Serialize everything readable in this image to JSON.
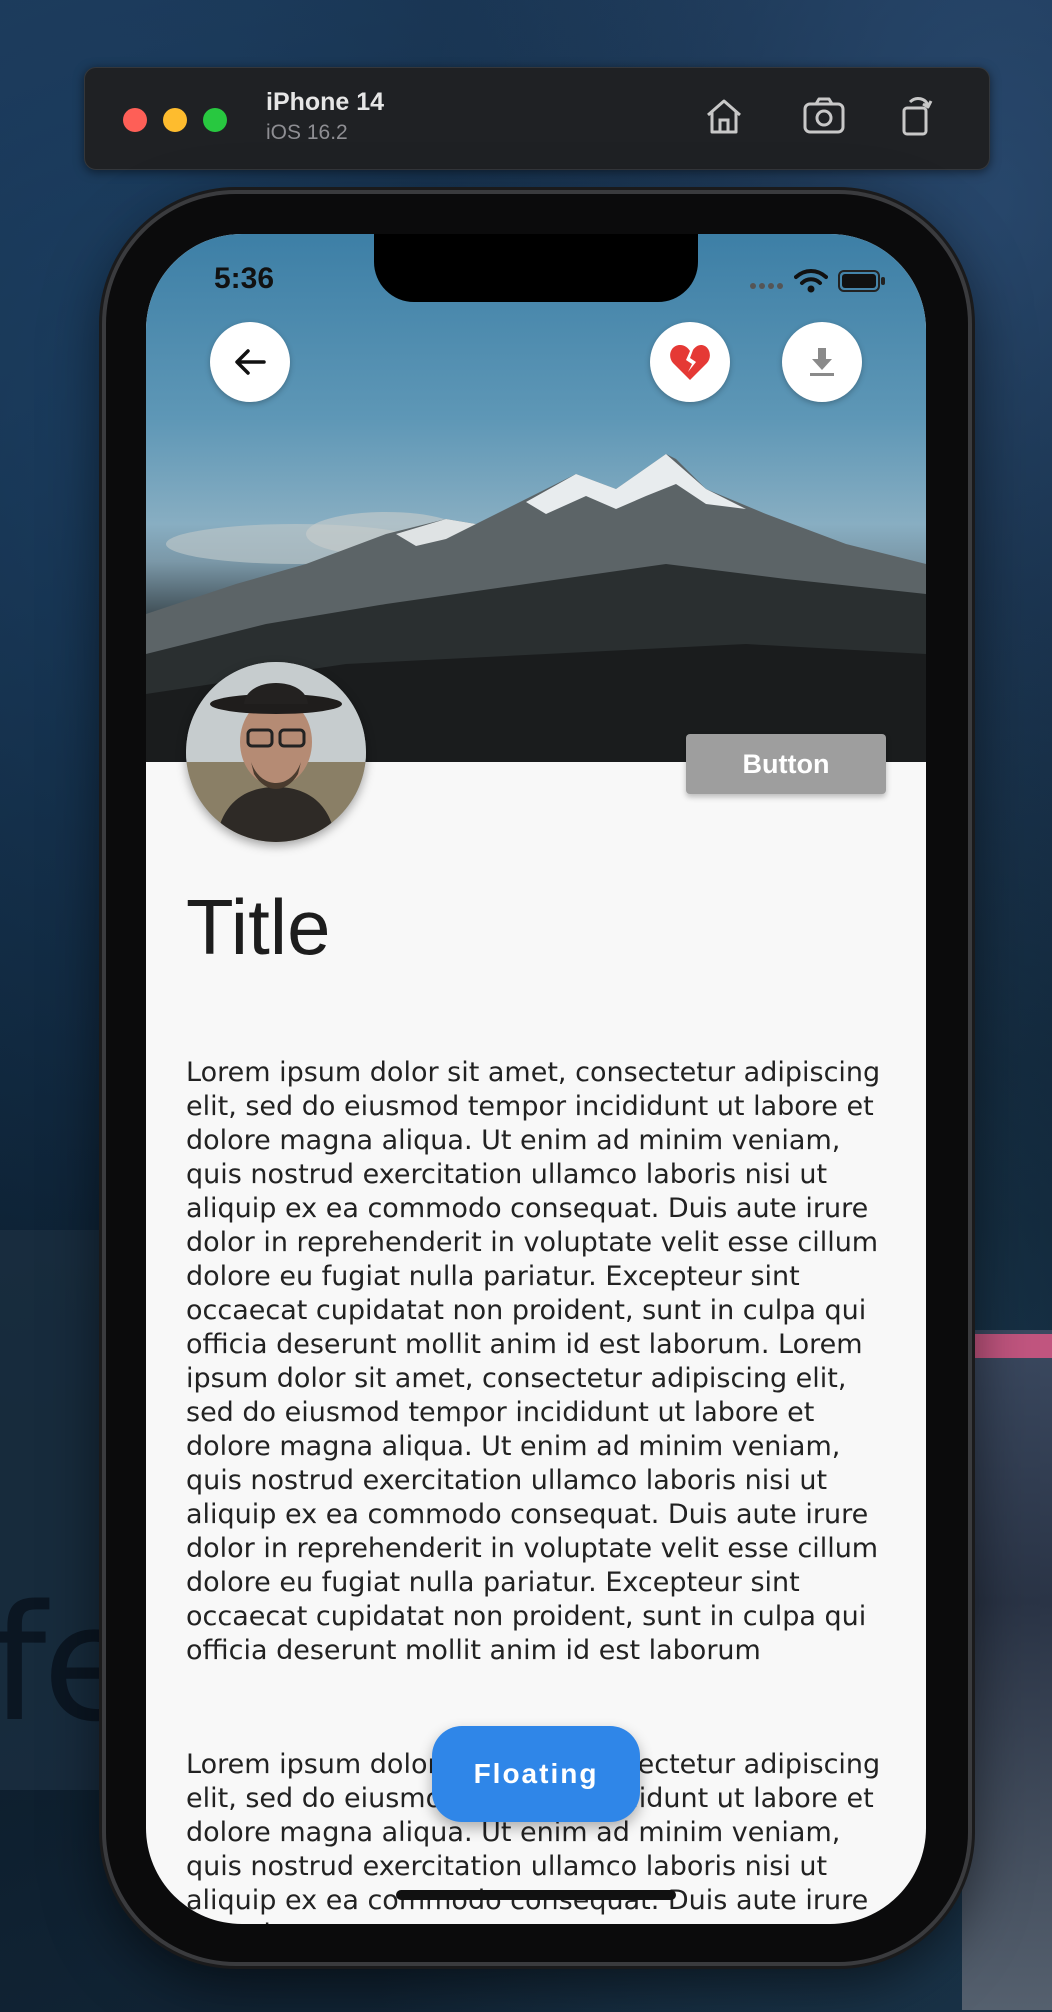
{
  "simulator": {
    "device_name": "iPhone 14",
    "os_version": "iOS 16.2",
    "icons": [
      "home-icon",
      "screenshot-icon",
      "rotate-icon"
    ]
  },
  "status_bar": {
    "time": "5:36",
    "icons": [
      "signal-icon",
      "wifi-icon",
      "battery-icon"
    ]
  },
  "header": {
    "back_icon": "arrow-left-icon",
    "favorite_icon": "broken-heart-icon",
    "download_icon": "download-icon",
    "accent_heart": "#e53935"
  },
  "profile": {
    "button_label": "Button"
  },
  "content": {
    "title": "Title",
    "paragraph_1": "Lorem ipsum dolor sit amet, consectetur adipiscing elit, sed do eiusmod tempor incididunt ut labore et dolore magna aliqua. Ut enim ad minim veniam, quis nostrud exercitation ullamco laboris nisi ut aliquip ex ea commodo consequat. Duis aute irure dolor in reprehenderit in voluptate velit esse cillum dolore eu fugiat nulla pariatur. Excepteur sint occaecat cupidatat non proident, sunt in culpa qui officia deserunt mollit anim id est laborum. Lorem ipsum dolor sit amet, consectetur adipiscing elit, sed do eiusmod tempor incididunt ut labore et dolore magna aliqua. Ut enim ad minim veniam, quis nostrud exercitation ullamco laboris nisi ut aliquip ex ea commodo consequat. Duis aute irure dolor in reprehenderit in voluptate velit esse cillum dolore eu fugiat nulla pariatur. Excepteur sint occaecat cupidatat non proident, sunt in culpa qui officia deserunt mollit anim id est laborum",
    "paragraph_2": "Lorem ipsum dolor sit amet, consectetur adipiscing elit, sed do eiusmod tempor incididunt ut labore et dolore magna aliqua. Ut enim ad minim veniam, quis nostrud exercitation ullamco laboris nisi ut aliquip ex ea commodo consequat. Duis aute irure dolor in"
  },
  "fab": {
    "label": "Floating",
    "color": "#2f86e8"
  }
}
